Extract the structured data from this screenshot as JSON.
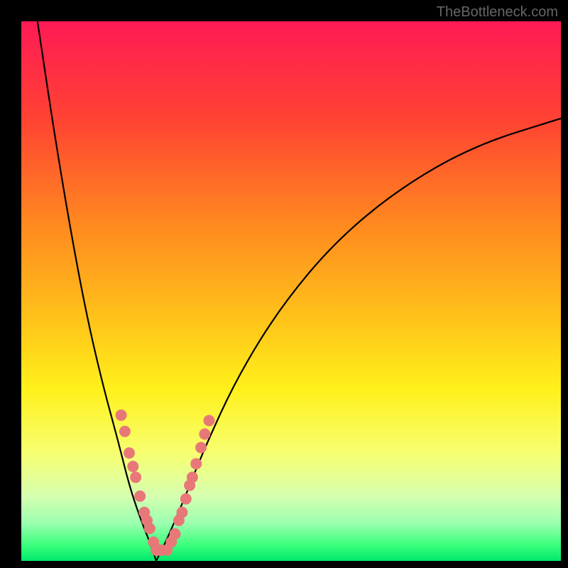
{
  "watermark": "TheBottleneck.com",
  "chart_data": {
    "type": "line",
    "title": "",
    "xlabel": "",
    "ylabel": "",
    "xlim": [
      0,
      100
    ],
    "ylim": [
      0,
      100
    ],
    "description": "Bottleneck percentage curve over gradient (red=high bottleneck, green=low). V-shape with minimum near x≈25 where bottleneck is near 0.",
    "gradient_stops": [
      {
        "pos": 0,
        "color": "#ff1a55"
      },
      {
        "pos": 18,
        "color": "#ff4233"
      },
      {
        "pos": 38,
        "color": "#ff8a1f"
      },
      {
        "pos": 55,
        "color": "#ffc21a"
      },
      {
        "pos": 68,
        "color": "#fff01a"
      },
      {
        "pos": 80,
        "color": "#f7ff70"
      },
      {
        "pos": 88,
        "color": "#d6ffb0"
      },
      {
        "pos": 93,
        "color": "#9cffb0"
      },
      {
        "pos": 97,
        "color": "#3cff7c"
      },
      {
        "pos": 100,
        "color": "#00e86b"
      }
    ],
    "series": [
      {
        "name": "left-branch",
        "color": "#000000",
        "x": [
          3,
          6,
          9,
          12,
          15,
          18,
          20,
          22,
          24,
          25
        ],
        "y": [
          100,
          80,
          62,
          46,
          33,
          22,
          14,
          8,
          3,
          0
        ]
      },
      {
        "name": "right-branch",
        "color": "#000000",
        "x": [
          25,
          27,
          30,
          34,
          40,
          48,
          58,
          70,
          84,
          100
        ],
        "y": [
          0,
          4,
          11,
          21,
          34,
          47,
          59,
          69,
          77,
          82
        ]
      }
    ],
    "markers": {
      "name": "data-points",
      "color": "#e87878",
      "radius": 8,
      "points": [
        {
          "x": 18.5,
          "y": 27
        },
        {
          "x": 19.2,
          "y": 24
        },
        {
          "x": 20.0,
          "y": 20
        },
        {
          "x": 20.7,
          "y": 17.5
        },
        {
          "x": 21.2,
          "y": 15.5
        },
        {
          "x": 22.0,
          "y": 12
        },
        {
          "x": 22.8,
          "y": 9
        },
        {
          "x": 23.3,
          "y": 7.5
        },
        {
          "x": 23.8,
          "y": 6
        },
        {
          "x": 24.5,
          "y": 3.5
        },
        {
          "x": 25.0,
          "y": 2
        },
        {
          "x": 25.5,
          "y": 2
        },
        {
          "x": 26.0,
          "y": 2
        },
        {
          "x": 27.0,
          "y": 2
        },
        {
          "x": 27.8,
          "y": 3.5
        },
        {
          "x": 28.5,
          "y": 5
        },
        {
          "x": 29.2,
          "y": 7.5
        },
        {
          "x": 29.8,
          "y": 9
        },
        {
          "x": 30.5,
          "y": 11.5
        },
        {
          "x": 31.2,
          "y": 14
        },
        {
          "x": 31.7,
          "y": 15.5
        },
        {
          "x": 32.4,
          "y": 18
        },
        {
          "x": 33.3,
          "y": 21
        },
        {
          "x": 34.0,
          "y": 23.5
        },
        {
          "x": 34.8,
          "y": 26
        }
      ]
    }
  }
}
